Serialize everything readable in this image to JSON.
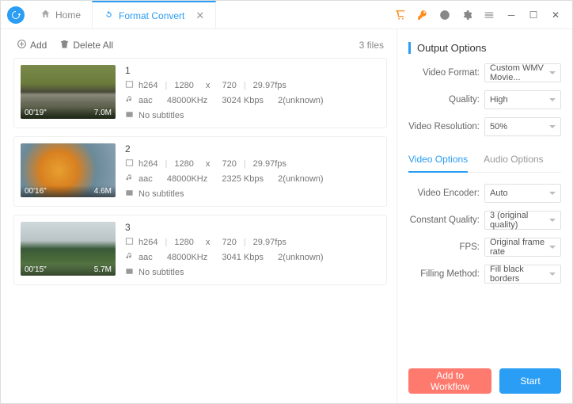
{
  "tabs": {
    "home": "Home",
    "convert": "Format Convert"
  },
  "toolbar": {
    "add": "Add",
    "delete_all": "Delete All",
    "count": "3 files"
  },
  "files": [
    {
      "name": "1",
      "duration": "00'19\"",
      "size": "7.0M",
      "v": {
        "codec": "h264",
        "w": "1280",
        "x": "x",
        "h": "720",
        "fps": "29.97fps"
      },
      "a": {
        "codec": "aac",
        "rate": "48000KHz",
        "bitrate": "3024 Kbps",
        "ch": "2(unknown)"
      },
      "sub": "No subtitles"
    },
    {
      "name": "2",
      "duration": "00'16\"",
      "size": "4.6M",
      "v": {
        "codec": "h264",
        "w": "1280",
        "x": "x",
        "h": "720",
        "fps": "29.97fps"
      },
      "a": {
        "codec": "aac",
        "rate": "48000KHz",
        "bitrate": "2325 Kbps",
        "ch": "2(unknown)"
      },
      "sub": "No subtitles"
    },
    {
      "name": "3",
      "duration": "00'15\"",
      "size": "5.7M",
      "v": {
        "codec": "h264",
        "w": "1280",
        "x": "x",
        "h": "720",
        "fps": "29.97fps"
      },
      "a": {
        "codec": "aac",
        "rate": "48000KHz",
        "bitrate": "3041 Kbps",
        "ch": "2(unknown)"
      },
      "sub": "No subtitles"
    }
  ],
  "output": {
    "title": "Output Options",
    "labels": {
      "format": "Video Format:",
      "quality": "Quality:",
      "resolution": "Video Resolution:"
    },
    "values": {
      "format": "Custom WMV Movie...",
      "quality": "High",
      "resolution": "50%"
    }
  },
  "opt_tabs": {
    "video": "Video Options",
    "audio": "Audio Options"
  },
  "video_opts": {
    "labels": {
      "encoder": "Video Encoder:",
      "cq": "Constant Quality:",
      "fps": "FPS:",
      "fill": "Filling Method:"
    },
    "values": {
      "encoder": "Auto",
      "cq": "3 (original quality)",
      "fps": "Original frame rate",
      "fill": "Fill black borders"
    }
  },
  "footer": {
    "workflow": "Add to Workflow",
    "start": "Start"
  }
}
